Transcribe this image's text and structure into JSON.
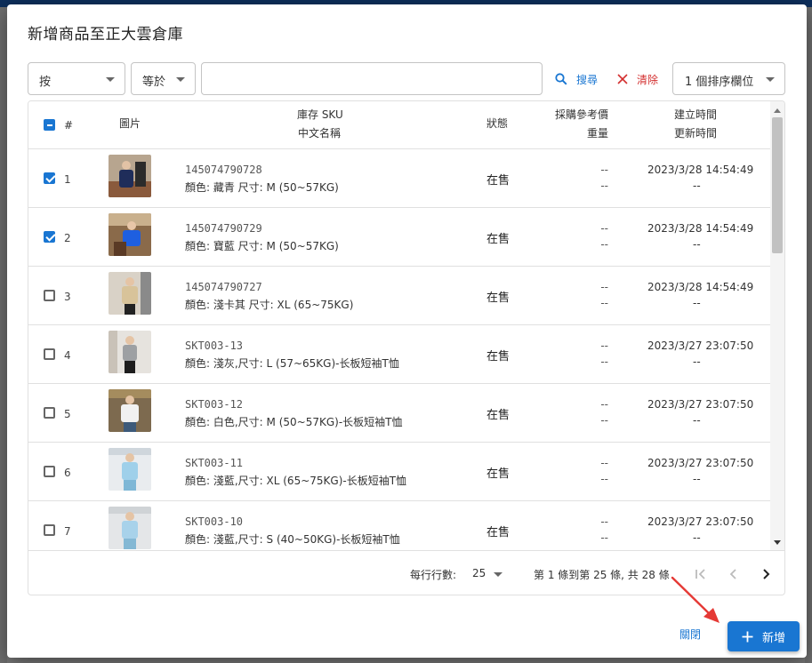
{
  "dialog": {
    "title": "新增商品至正大雲倉庫"
  },
  "filter": {
    "column_value": "按",
    "operator_value": "等於",
    "search_value": "",
    "search_label": "搜尋",
    "clear_label": "清除",
    "sort_label": "1 個排序欄位"
  },
  "table": {
    "headers": {
      "index": "#",
      "image": "圖片",
      "sku": "庫存 SKU",
      "name": "中文名稱",
      "status": "狀態",
      "price": "採購參考價",
      "weight": "重量",
      "created": "建立時間",
      "updated": "更新時間"
    },
    "rows": [
      {
        "num": "1",
        "checked": true,
        "sku": "145074790728",
        "name": "顏色: 藏青 尺寸: M (50~57KG)",
        "status": "在售",
        "price": "--",
        "weight": "--",
        "created": "2023/3/28 14:54:49",
        "updated": "--"
      },
      {
        "num": "2",
        "checked": true,
        "sku": "145074790729",
        "name": "顏色: 寶藍 尺寸: M (50~57KG)",
        "status": "在售",
        "price": "--",
        "weight": "--",
        "created": "2023/3/28 14:54:49",
        "updated": "--"
      },
      {
        "num": "3",
        "checked": false,
        "sku": "145074790727",
        "name": "顏色: 淺卡其 尺寸: XL (65~75KG)",
        "status": "在售",
        "price": "--",
        "weight": "--",
        "created": "2023/3/28 14:54:49",
        "updated": "--"
      },
      {
        "num": "4",
        "checked": false,
        "sku": "SKT003-13",
        "name": "顏色: 淺灰,尺寸: L (57~65KG)-长板短袖T恤",
        "status": "在售",
        "price": "--",
        "weight": "--",
        "created": "2023/3/27 23:07:50",
        "updated": "--"
      },
      {
        "num": "5",
        "checked": false,
        "sku": "SKT003-12",
        "name": "顏色: 白色,尺寸: M (50~57KG)-长板短袖T恤",
        "status": "在售",
        "price": "--",
        "weight": "--",
        "created": "2023/3/27 23:07:50",
        "updated": "--"
      },
      {
        "num": "6",
        "checked": false,
        "sku": "SKT003-11",
        "name": "顏色: 淺藍,尺寸: XL (65~75KG)-长板短袖T恤",
        "status": "在售",
        "price": "--",
        "weight": "--",
        "created": "2023/3/27 23:07:50",
        "updated": "--"
      },
      {
        "num": "7",
        "checked": false,
        "sku": "SKT003-10",
        "name": "顏色: 淺藍,尺寸: S (40~50KG)-长板短袖T恤",
        "status": "在售",
        "price": "--",
        "weight": "--",
        "created": "2023/3/27 23:07:50",
        "updated": "--"
      }
    ]
  },
  "pagination": {
    "rows_per_page_label": "每行行數:",
    "rows_per_page": "25",
    "range_text": "第 1 條到第 25 條, 共 28 條"
  },
  "footer": {
    "close_label": "關閉",
    "add_label": "新增"
  },
  "colors": {
    "primary": "#1976d2",
    "danger": "#d32f2f",
    "annotation_arrow": "#e53935"
  }
}
